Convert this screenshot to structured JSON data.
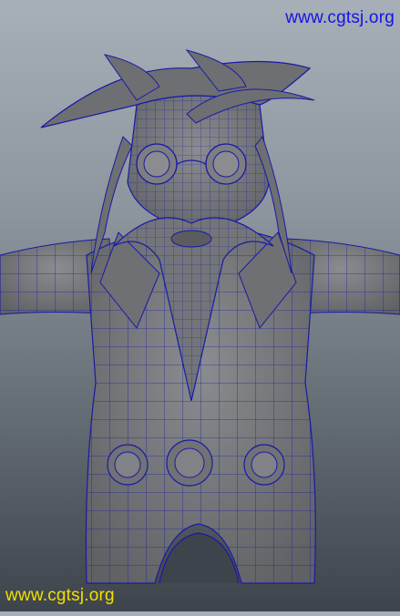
{
  "viewport": {
    "subject": "wireframe-character-model",
    "background_top": "#a7afb8",
    "background_bottom": "#3e444b",
    "mesh_color": "#7b7d80",
    "wire_color": "#1a1aa6"
  },
  "watermarks": {
    "top": "www.cgtsj.org",
    "bottom": "www.cgtsj.org",
    "top_color": "#1414e6",
    "bottom_color": "#f0e000"
  }
}
